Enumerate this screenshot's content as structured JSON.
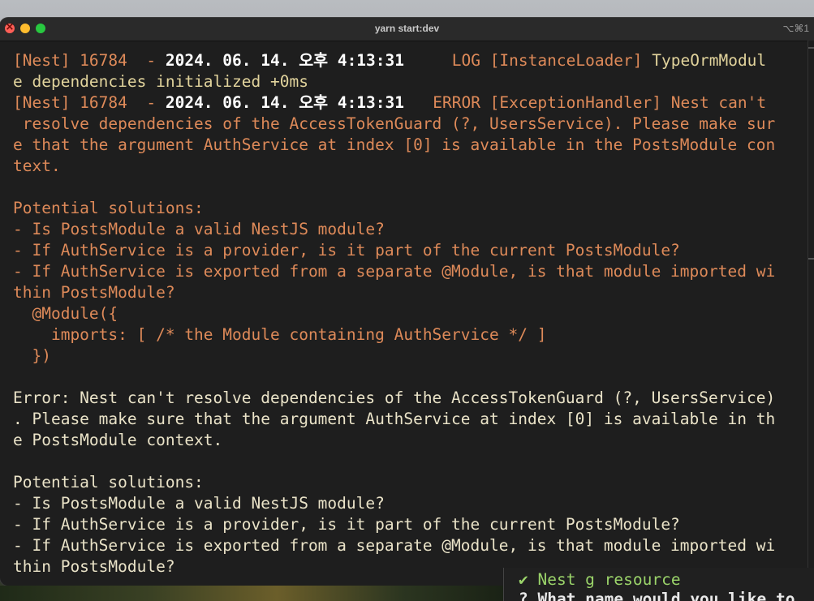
{
  "window": {
    "title": "yarn start:dev",
    "shortcut": "⌥⌘1"
  },
  "terminal": {
    "lines": [
      [
        {
          "t": "[Nest] 16784  - ",
          "c": "o"
        },
        {
          "t": "2024. 06. 14. 오후 4:13:31",
          "c": "b"
        },
        {
          "t": "     LOG ",
          "c": "o"
        },
        {
          "t": "[InstanceLoader] ",
          "c": "o"
        },
        {
          "t": "TypeOrmModul",
          "c": "l"
        }
      ],
      [
        {
          "t": "e dependencies initialized ",
          "c": "l"
        },
        {
          "t": "+0ms",
          "c": "l"
        }
      ],
      [
        {
          "t": "[Nest] 16784  - ",
          "c": "o"
        },
        {
          "t": "2024. 06. 14. 오후 4:13:31",
          "c": "b"
        },
        {
          "t": "   ERROR [ExceptionHandler] Nest can't",
          "c": "o"
        }
      ],
      [
        {
          "t": " resolve dependencies of the AccessTokenGuard (?, UsersService). Please make sur",
          "c": "o"
        }
      ],
      [
        {
          "t": "e that the argument AuthService at index [0] is available in the PostsModule con",
          "c": "o"
        }
      ],
      [
        {
          "t": "text.",
          "c": "o"
        }
      ],
      [
        {
          "t": "",
          "c": "o"
        }
      ],
      [
        {
          "t": "Potential solutions:",
          "c": "o"
        }
      ],
      [
        {
          "t": "- Is PostsModule a valid NestJS module?",
          "c": "o"
        }
      ],
      [
        {
          "t": "- If AuthService is a provider, is it part of the current PostsModule?",
          "c": "o"
        }
      ],
      [
        {
          "t": "- If AuthService is exported from a separate @Module, is that module imported wi",
          "c": "o"
        }
      ],
      [
        {
          "t": "thin PostsModule?",
          "c": "o"
        }
      ],
      [
        {
          "t": "  @Module({",
          "c": "o"
        }
      ],
      [
        {
          "t": "    imports: [ /* the Module containing AuthService */ ]",
          "c": "o"
        }
      ],
      [
        {
          "t": "  })",
          "c": "o"
        }
      ],
      [
        {
          "t": "",
          "c": "w"
        }
      ],
      [
        {
          "t": "Error: Nest can't resolve dependencies of the AccessTokenGuard (?, UsersService)",
          "c": "w"
        }
      ],
      [
        {
          "t": ". Please make sure that the argument AuthService at index [0] is available in th",
          "c": "w"
        }
      ],
      [
        {
          "t": "e PostsModule context.",
          "c": "w"
        }
      ],
      [
        {
          "t": "",
          "c": "w"
        }
      ],
      [
        {
          "t": "Potential solutions:",
          "c": "w"
        }
      ],
      [
        {
          "t": "- Is PostsModule a valid NestJS module?",
          "c": "w"
        }
      ],
      [
        {
          "t": "- If AuthService is a provider, is it part of the current PostsModule?",
          "c": "w"
        }
      ],
      [
        {
          "t": "- If AuthService is exported from a separate @Module, is that module imported wi",
          "c": "w"
        }
      ],
      [
        {
          "t": "thin PostsModule?",
          "c": "w"
        }
      ]
    ]
  },
  "background_window": {
    "row1": "✔ Nest g resource",
    "row2": "? What name would you like to"
  },
  "colors": {
    "terminal_bg": "#1e1e1e",
    "log_orange": "#de8a59",
    "text_cream": "#eae3c8",
    "timestamp_white": "#ffffff"
  }
}
